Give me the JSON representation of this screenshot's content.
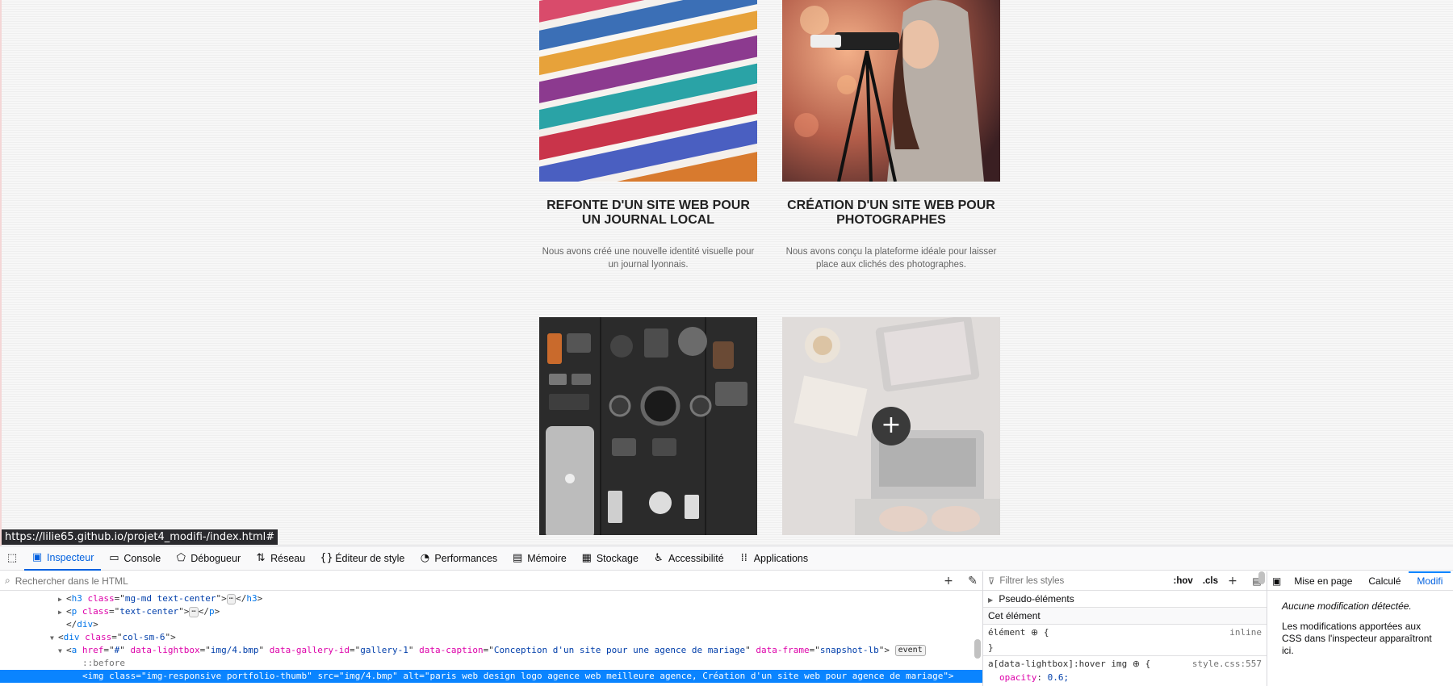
{
  "portfolio": {
    "cards": [
      {
        "title": "REFONTE D'UN SITE WEB POUR UN JOURNAL LOCAL",
        "desc": "Nous avons créé une nouvelle identité visuelle pour un journal lyonnais.",
        "image": "magazines-photo"
      },
      {
        "title": "CRÉATION D'UN SITE WEB POUR PHOTOGRAPHES",
        "desc": "Nous avons conçu la plateforme idéale pour laisser place aux clichés des photographes.",
        "image": "photographer-photo"
      },
      {
        "image": "camera-gear-flatlay-photo"
      },
      {
        "image": "laptop-desk-photo",
        "overlay_icon": "+"
      }
    ]
  },
  "status_url": "https://lilie65.github.io/projet4_modifi-/index.html#",
  "devtools": {
    "toolbar": [
      {
        "label": "Inspecteur",
        "icon": "inspector-icon",
        "active": true
      },
      {
        "label": "Console",
        "icon": "console-icon"
      },
      {
        "label": "Débogueur",
        "icon": "debugger-icon"
      },
      {
        "label": "Réseau",
        "icon": "network-icon"
      },
      {
        "label": "Éditeur de style",
        "icon": "style-editor-icon"
      },
      {
        "label": "Performances",
        "icon": "performance-icon"
      },
      {
        "label": "Mémoire",
        "icon": "memory-icon"
      },
      {
        "label": "Stockage",
        "icon": "storage-icon"
      },
      {
        "label": "Accessibilité",
        "icon": "accessibility-icon"
      },
      {
        "label": "Applications",
        "icon": "applications-icon"
      }
    ],
    "html_search_placeholder": "Rechercher dans le HTML",
    "html_lines": [
      {
        "indent": 8,
        "twisty": "▶",
        "parts": [
          [
            "p",
            "<"
          ],
          [
            "t",
            "h3"
          ],
          [
            "p",
            " "
          ],
          [
            "a",
            "class"
          ],
          [
            "p",
            "=\""
          ],
          [
            "v",
            "mg-md text-center"
          ],
          [
            "p",
            "\">"
          ]
        ],
        "pill": "⋯",
        "after": [
          [
            "p",
            "</"
          ],
          [
            "t",
            "h3"
          ],
          [
            "p",
            ">"
          ]
        ]
      },
      {
        "indent": 8,
        "twisty": "▶",
        "parts": [
          [
            "p",
            "<"
          ],
          [
            "t",
            "p"
          ],
          [
            "p",
            " "
          ],
          [
            "a",
            "class"
          ],
          [
            "p",
            "=\""
          ],
          [
            "v",
            "text-center"
          ],
          [
            "p",
            "\">"
          ]
        ],
        "pill": "⋯",
        "after": [
          [
            "p",
            "</"
          ],
          [
            "t",
            "p"
          ],
          [
            "p",
            ">"
          ]
        ]
      },
      {
        "indent": 8,
        "twisty": "",
        "parts": [
          [
            "p",
            "</"
          ],
          [
            "t",
            "div"
          ],
          [
            "p",
            ">"
          ]
        ]
      },
      {
        "indent": 7,
        "twisty": "▼",
        "parts": [
          [
            "p",
            "<"
          ],
          [
            "t",
            "div"
          ],
          [
            "p",
            " "
          ],
          [
            "a",
            "class"
          ],
          [
            "p",
            "=\""
          ],
          [
            "v",
            "col-sm-6"
          ],
          [
            "p",
            "\">"
          ]
        ]
      },
      {
        "indent": 8,
        "twisty": "▼",
        "parts": [
          [
            "p",
            "<"
          ],
          [
            "t",
            "a"
          ],
          [
            "p",
            " "
          ],
          [
            "a",
            "href"
          ],
          [
            "p",
            "=\""
          ],
          [
            "v",
            "#"
          ],
          [
            "p",
            "\" "
          ],
          [
            "a",
            "data-lightbox"
          ],
          [
            "p",
            "=\""
          ],
          [
            "v",
            "img/4.bmp"
          ],
          [
            "p",
            "\" "
          ],
          [
            "a",
            "data-gallery-id"
          ],
          [
            "p",
            "=\""
          ],
          [
            "v",
            "gallery-1"
          ],
          [
            "p",
            "\" "
          ],
          [
            "a",
            "data-caption"
          ],
          [
            "p",
            "=\""
          ],
          [
            "v",
            "Conception d'un site pour une agence de mariage"
          ],
          [
            "p",
            "\" "
          ],
          [
            "a",
            "data-frame"
          ],
          [
            "p",
            "=\""
          ],
          [
            "v",
            "snapshot-lb"
          ],
          [
            "p",
            "\">"
          ]
        ],
        "badge": "event"
      },
      {
        "indent": 10,
        "twisty": "",
        "pseudo": "::before"
      },
      {
        "indent": 10,
        "twisty": "",
        "selected": true,
        "parts": [
          [
            "p",
            "<"
          ],
          [
            "t",
            "img"
          ],
          [
            "p",
            " "
          ],
          [
            "a",
            "class"
          ],
          [
            "p",
            "=\""
          ],
          [
            "v",
            "img-responsive portfolio-thumb"
          ],
          [
            "p",
            "\" "
          ],
          [
            "a",
            "src"
          ],
          [
            "p",
            "=\""
          ],
          [
            "v",
            "img/4.bmp"
          ],
          [
            "p",
            "\" "
          ],
          [
            "a",
            "alt"
          ],
          [
            "p",
            "=\""
          ],
          [
            "v",
            "paris web design logo agence web meilleure agence, Création d'un site web pour agence de mariage"
          ],
          [
            "p",
            "\">"
          ]
        ]
      }
    ],
    "rules": {
      "filter_placeholder": "Filtrer les styles",
      "hov": ":hov",
      "cls": ".cls",
      "pseudo_elements": "Pseudo-éléments",
      "this_element": "Cet élément",
      "element_rule": {
        "selector": "élément",
        "brace": "{",
        "source": "inline",
        "close": "}"
      },
      "hover_rule": {
        "selector": "a[data-lightbox]:hover img",
        "brace": "{",
        "source": "style.css:557",
        "prop": "opacity",
        "value": "0.6;"
      }
    },
    "right_tabs": [
      "Mise en page",
      "Calculé",
      "Modifi"
    ],
    "changes_title": "Aucune modification détectée.",
    "changes_text": "Les modifications apportées aux CSS dans l'inspecteur apparaîtront ici."
  }
}
